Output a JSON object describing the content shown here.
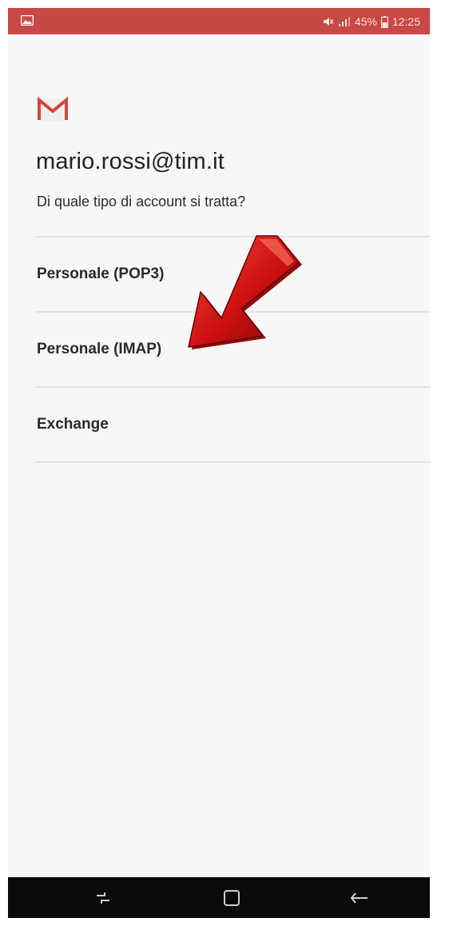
{
  "status_bar": {
    "left_icon": "image-notification-icon",
    "right_icons": [
      "mute-icon",
      "signal-icon"
    ],
    "battery": "45%",
    "time": "12:25",
    "color": "#c84845"
  },
  "app": {
    "logo_icon": "gmail-m-icon",
    "brand_color": "#d44638"
  },
  "header": {
    "email": "mario.rossi@tim.it",
    "question": "Di quale tipo di account si tratta?"
  },
  "options": [
    {
      "label": "Personale (POP3)"
    },
    {
      "label": "Personale (IMAP)"
    },
    {
      "label": "Exchange"
    }
  ],
  "annotation": {
    "arrow_icon": "red-pointer-arrow-icon",
    "points_to": "Personale (IMAP)",
    "color": "#cc1010"
  },
  "nav_bar": {
    "buttons": [
      "recent-apps-icon",
      "home-icon",
      "back-icon"
    ]
  }
}
